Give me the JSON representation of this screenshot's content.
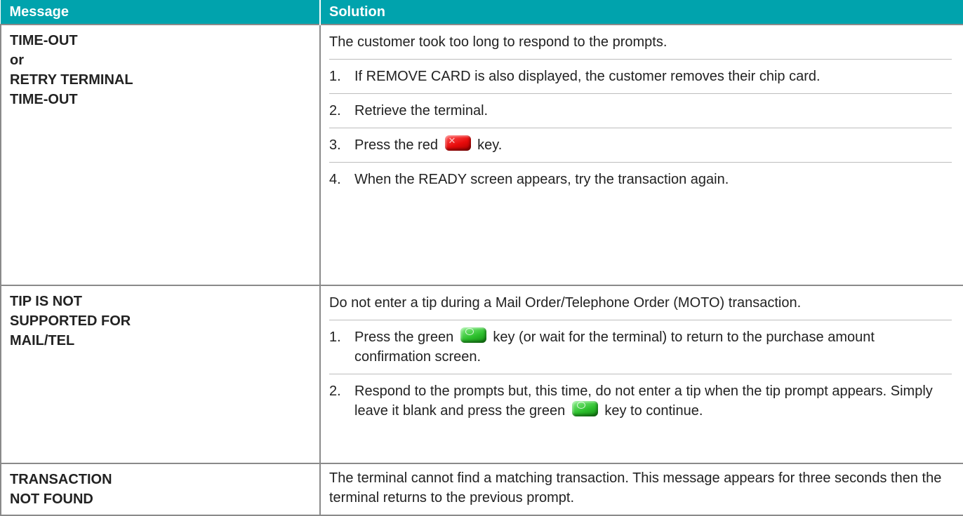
{
  "header": {
    "col1": "Message",
    "col2": "Solution"
  },
  "rows": [
    {
      "message": [
        "TIME-OUT",
        "or",
        "RETRY TERMINAL",
        "TIME-OUT"
      ],
      "intro": "The customer took too long to respond to the prompts.",
      "steps": [
        {
          "num": "1.",
          "text": "If REMOVE CARD is also displayed, the customer removes their chip card."
        },
        {
          "num": "2.",
          "text": "Retrieve the terminal."
        },
        {
          "num": "3.",
          "pre": "Press the red",
          "post": "key."
        },
        {
          "num": "4.",
          "text": "When the READY screen appears, try the transaction again."
        }
      ]
    },
    {
      "message": [
        "TIP IS NOT",
        "SUPPORTED FOR",
        "MAIL/TEL"
      ],
      "intro": "Do not enter a tip during a Mail Order/Telephone Order (MOTO) transaction.",
      "steps": [
        {
          "num": "1.",
          "pre": "Press the green",
          "post": "key (or wait for the terminal) to return to the purchase amount confirmation screen."
        },
        {
          "num": "2.",
          "pre": "Respond to the prompts but, this time, do not enter a tip when the tip prompt appears. Simply leave it blank and press the green",
          "post": "key to continue."
        }
      ]
    },
    {
      "message": [
        "TRANSACTION",
        "NOT FOUND"
      ],
      "intro": "The terminal cannot find a matching transaction. This message appears for three seconds then the terminal returns to the previous prompt."
    }
  ],
  "keys": {
    "red_icon": "red-cancel-key-icon",
    "green_icon": "green-ok-key-icon",
    "red_color": "#e80b0b",
    "green_color": "#2ec12e"
  },
  "colors": {
    "header_bg": "#00a3ad",
    "border": "#8a8a8a"
  }
}
